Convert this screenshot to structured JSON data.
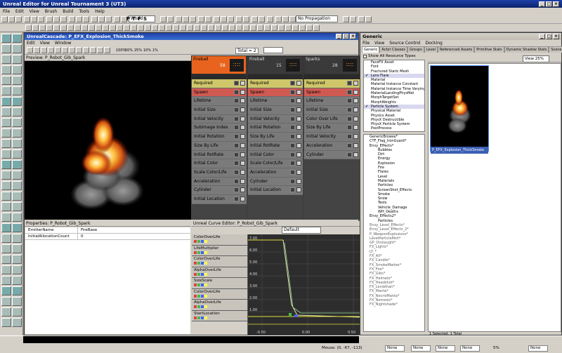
{
  "app_title": "Unreal Editor for Unreal Tournament 3 (UT3)",
  "main_menu": [
    "File",
    "Edit",
    "View",
    "Brush",
    "Build",
    "Tools",
    "Help"
  ],
  "toolbar": {
    "world_combo": "World",
    "propagation_combo": "No Propagation",
    "view_letters": [
      "P",
      "T",
      "F",
      "S"
    ]
  },
  "cascade": {
    "title": "UnrealCascade: P_EFX_Explosion_ThickSmoke",
    "menu": [
      "Edit",
      "View",
      "Window"
    ],
    "speeds": [
      "100%",
      "50%",
      "25%",
      "10%",
      "1%"
    ],
    "total_label": "Total = 2",
    "actor_combo": "",
    "preview_label": "Preview: P_Robot_Gib_Spark",
    "emitters": [
      {
        "name": "Fireball",
        "count": "58",
        "color": "#e8641e"
      },
      {
        "name": "Fireball",
        "count": "15",
        "color": "#3a3a3a"
      },
      {
        "name": "Sparks",
        "count": "28",
        "color": "#3a3a3a"
      }
    ],
    "col1": [
      {
        "label": "Required",
        "color": "#cfc66a"
      },
      {
        "label": "Spawn",
        "color": "#d05a52"
      },
      {
        "label": "Lifetime",
        "color": "#7a7a7a"
      },
      {
        "label": "Initial Size",
        "color": "#7a7a7a"
      },
      {
        "label": "Initial Velocity",
        "color": "#7a7a7a"
      },
      {
        "label": "SubImage Index",
        "color": "#7a7a7a"
      },
      {
        "label": "Initial Rotation",
        "color": "#7a7a7a"
      },
      {
        "label": "Size By Life",
        "color": "#7a7a7a"
      },
      {
        "label": "Initial RotRate",
        "color": "#7a7a7a"
      },
      {
        "label": "Initial Color",
        "color": "#7a7a7a"
      },
      {
        "label": "Scale Color/Life",
        "color": "#7a7a7a"
      },
      {
        "label": "Acceleration",
        "color": "#7a7a7a"
      },
      {
        "label": "Cylinder",
        "color": "#7a7a7a"
      },
      {
        "label": "Initial Location",
        "color": "#7a7a7a"
      }
    ],
    "col2": [
      {
        "label": "Required",
        "color": "#cfc66a"
      },
      {
        "label": "Spawn",
        "color": "#d05a52"
      },
      {
        "label": "Lifetime",
        "color": "#7a7a7a"
      },
      {
        "label": "Initial Size",
        "color": "#7a7a7a"
      },
      {
        "label": "Initial Velocity",
        "color": "#7a7a7a"
      },
      {
        "label": "Initial Rotation",
        "color": "#7a7a7a"
      },
      {
        "label": "Size By Life",
        "color": "#7a7a7a"
      },
      {
        "label": "Initial RotRate",
        "color": "#7a7a7a"
      },
      {
        "label": "Initial Color",
        "color": "#7a7a7a"
      },
      {
        "label": "Scale Color/Life",
        "color": "#7a7a7a"
      },
      {
        "label": "Acceleration",
        "color": "#7a7a7a"
      },
      {
        "label": "Cylinder",
        "color": "#7a7a7a"
      },
      {
        "label": "Initial Location",
        "color": "#7a7a7a"
      }
    ],
    "col3": [
      {
        "label": "Required",
        "color": "#cfc66a"
      },
      {
        "label": "Spawn",
        "color": "#d05a52"
      },
      {
        "label": "Lifetime",
        "color": "#7a7a7a"
      },
      {
        "label": "Initial Size",
        "color": "#7a7a7a"
      },
      {
        "label": "Color Over Life",
        "color": "#7a7a7a"
      },
      {
        "label": "Size By Life",
        "color": "#7a7a7a"
      },
      {
        "label": "Initial Velocity",
        "color": "#7a7a7a"
      },
      {
        "label": "Acceleration",
        "color": "#7a7a7a"
      },
      {
        "label": "Cylinder",
        "color": "#7a7a7a"
      }
    ],
    "properties_title": "Properties: P_Robot_Gib_Spark",
    "properties": [
      {
        "key": "EmitterName",
        "value": "FireBase"
      },
      {
        "key": "InitialAllocationCount",
        "value": "0"
      }
    ],
    "curve_title": "Unreal Curve Editor: P_Robot_Gib_Spark",
    "curve_combo": "Default",
    "curves": [
      "ColorOverLife",
      "LifeMultiplier",
      "ColorOverLife",
      "AlphaOverLife",
      "SizeScale",
      "ColorOverLife",
      "AlphaOverLife",
      "StartLocation"
    ],
    "y_ticks": [
      "7.00",
      "6.00",
      "5.00",
      "4.00",
      "3.00",
      "2.00",
      "1.00"
    ],
    "x_ticks": [
      "-0.50",
      "0.00",
      "0.50"
    ]
  },
  "generic": {
    "title": "Generic",
    "menu": [
      "File",
      "View",
      "Source Control",
      "Docking"
    ],
    "tabs": [
      "Generic",
      "Actor Classes",
      "Groups",
      "Level",
      "Referenced Assets",
      "Primitive Stats",
      "Dynamic Shadow Stats",
      "Scene Manager"
    ],
    "show_all": "Show All Resource Types",
    "types": [
      "FaceFX Asset",
      "Font",
      "Fractured Static Mesh",
      "Lens Flare",
      "Material",
      "Material Instance Constant",
      "Material Instance Time Varying",
      "MaterialLandingPhysMat",
      "MorphTargetSet",
      "MorphWeights",
      "Particle System",
      "Physical Material",
      "Physics Asset",
      "PhysX Destructible",
      "PhysX Particle System",
      "PostProcess"
    ],
    "checked_types": [
      "Lens Flare",
      "Particle System"
    ],
    "packages": [
      "GenericBrowse*",
      "CTF_Flag_IronGuard*",
      "Envy_Effects*",
      "Bubbles",
      "Dirt",
      "Energy",
      "Explosion",
      "Fire",
      "Flares",
      "Level",
      "Materials",
      "Particles",
      "ScreenShot_Effects",
      "Smoke",
      "Snow",
      "Tests",
      "Vehicle_Damage",
      "WH_Deaths",
      "Envy_Effects2*",
      "Particles",
      "Envy_Level_Effects*",
      "Envy_Level_Effects_2*",
      "P_WeaponExplosions*",
      "LevelParticleMsh*",
      "GP_Onslaught*",
      "FX_Lights*",
      "LT_*",
      "FX_All*",
      "FX_Candle*",
      "FX_SmokeMarker*",
      "FX_Fire*",
      "FX_Gibs*",
      "FX_Helmets*",
      "FX_Headshot*",
      "FX_Leviathan*",
      "FX_Manta*",
      "FX_NecrisManta*",
      "FX_Nemesis*",
      "FX_Nightshade*"
    ],
    "zoom": "View 25%",
    "thumb_label": "P_EFX_Explosion_ThickSmoke",
    "status": "1 Selected, 1 Total"
  },
  "status": {
    "mouse": "Mouse: (0, -67, -113)",
    "boxes": [
      "None",
      "None",
      "None",
      "None",
      "None"
    ],
    "zoom_pct": "5%"
  }
}
